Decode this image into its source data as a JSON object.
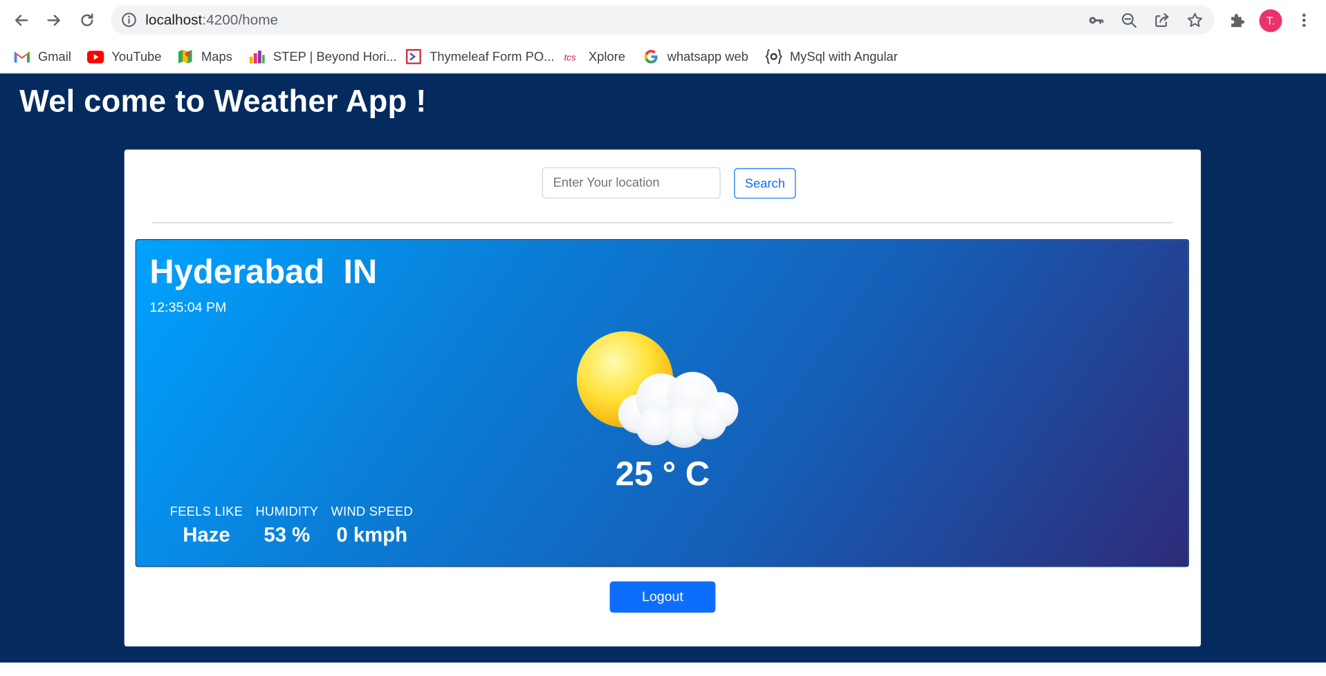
{
  "browser": {
    "url_host": "localhost",
    "url_path": ":4200/home",
    "avatar_letter": "T.",
    "avatar_color": "#e8336d"
  },
  "bookmarks": [
    {
      "label": "Gmail",
      "icon": "gmail-icon"
    },
    {
      "label": "YouTube",
      "icon": "youtube-icon"
    },
    {
      "label": "Maps",
      "icon": "maps-icon"
    },
    {
      "label": "STEP | Beyond Hori...",
      "icon": "step-icon"
    },
    {
      "label": "Thymeleaf Form PO...",
      "icon": "thymeleaf-icon"
    },
    {
      "label": "Xplore",
      "icon": "tcs-icon"
    },
    {
      "label": "whatsapp web",
      "icon": "google-icon"
    },
    {
      "label": "MySql with Angular",
      "icon": "braces-icon"
    }
  ],
  "app": {
    "title": "Wel come to Weather App !",
    "search_placeholder": "Enter Your location",
    "search_label": "Search",
    "logout_label": "Logout"
  },
  "weather": {
    "city": "Hyderabad  IN",
    "time": "12:35:04 PM",
    "temperature": "25 ° C",
    "icon": "partly-cloudy-icon",
    "stats": [
      {
        "label": "FEELS LIKE",
        "value": "Haze"
      },
      {
        "label": "HUMIDITY",
        "value": "53 %"
      },
      {
        "label": "WIND SPEED",
        "value": "0 kmph"
      }
    ]
  },
  "colors": {
    "page_background": "#042a5e",
    "primary": "#0d6efd",
    "gradient_start": "#00a2ff",
    "gradient_end": "#2e2b78"
  }
}
